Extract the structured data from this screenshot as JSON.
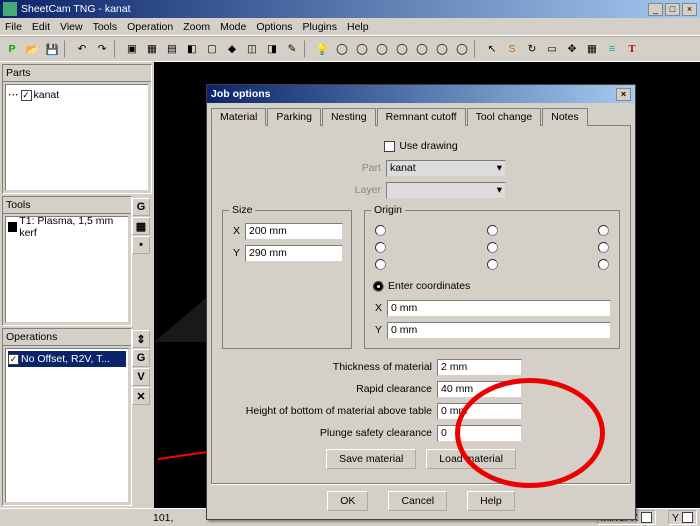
{
  "window": {
    "title": "SheetCam TNG - kanat",
    "min": "_",
    "max": "□",
    "close": "×"
  },
  "menus": [
    "File",
    "Edit",
    "View",
    "Tools",
    "Operation",
    "Zoom",
    "Mode",
    "Options",
    "Plugins",
    "Help"
  ],
  "panels": {
    "parts": {
      "title": "Parts",
      "item": "kanat"
    },
    "tools": {
      "title": "Tools",
      "item": "T1: Plasma, 1,5 mm kerf"
    },
    "ops": {
      "title": "Operations",
      "item": "No Offset, R2V, T..."
    }
  },
  "sidebtns_tools": [
    "G",
    "▦",
    "•"
  ],
  "sidebtns_ops": [
    "⇕",
    "G",
    "V",
    "✕"
  ],
  "dialog": {
    "title": "Job options",
    "tabs": [
      "Material",
      "Parking",
      "Nesting",
      "Remnant cutoff",
      "Tool change",
      "Notes"
    ],
    "use_drawing": "Use drawing",
    "part_label": "Part",
    "part_value": "kanat",
    "layer_label": "Layer",
    "layer_value": "",
    "size_label": "Size",
    "x_label": "X",
    "y_label": "Y",
    "x_value": "200 mm",
    "y_value": "290 mm",
    "origin_label": "Origin",
    "enter_coords": "Enter coordinates",
    "ox_label": "X",
    "oy_label": "Y",
    "ox_value": "0 mm",
    "oy_value": "0 mm",
    "thickness_label": "Thickness of material",
    "thickness_value": "2 mm",
    "rapid_label": "Rapid clearance",
    "rapid_value": "40 mm",
    "height_label": "Height of bottom of material above table",
    "height_value": "0 mm",
    "plunge_label": "Plunge safety clearance",
    "plunge_value": "0",
    "save_mat": "Save material",
    "load_mat": "Load material",
    "ok": "OK",
    "cancel": "Cancel",
    "help": "Help"
  },
  "status": {
    "coords": "101,",
    "mirrorx": "Mirror X",
    "y": "Y"
  }
}
